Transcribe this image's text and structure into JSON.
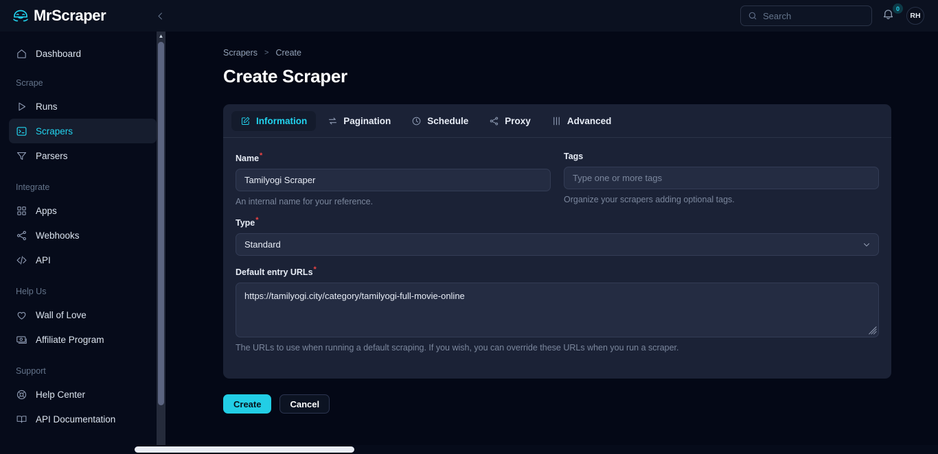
{
  "topbar": {
    "brand_name": "MrScraper",
    "logo_icon": "mrscraper-face-logo",
    "collapse_icon": "chevron-left-icon",
    "search": {
      "placeholder": "Search",
      "value": "",
      "icon": "search-icon"
    },
    "notifications": {
      "icon": "bell-icon",
      "count": "0"
    },
    "avatar_initials": "RH"
  },
  "sidebar": {
    "items": [
      {
        "label": "Dashboard",
        "icon": "home-icon",
        "active": false
      },
      {
        "label": "Runs",
        "icon": "play-icon",
        "active": false
      },
      {
        "label": "Scrapers",
        "icon": "terminal-icon",
        "active": true
      },
      {
        "label": "Parsers",
        "icon": "filter-icon",
        "active": false
      },
      {
        "label": "Apps",
        "icon": "grid-icon",
        "active": false
      },
      {
        "label": "Webhooks",
        "icon": "share-icon",
        "active": false
      },
      {
        "label": "API",
        "icon": "code-icon",
        "active": false
      },
      {
        "label": "Wall of Love",
        "icon": "heart-icon",
        "active": false
      },
      {
        "label": "Affiliate Program",
        "icon": "money-icon",
        "active": false
      },
      {
        "label": "Help Center",
        "icon": "lifebuoy-icon",
        "active": false
      },
      {
        "label": "API Documentation",
        "icon": "book-icon",
        "active": false
      }
    ],
    "groups": {
      "scrape": "Scrape",
      "integrate": "Integrate",
      "help_us": "Help Us",
      "support": "Support"
    }
  },
  "main": {
    "breadcrumb": {
      "parent": "Scrapers",
      "separator": ">",
      "current": "Create"
    },
    "page_title": "Create Scraper",
    "tabs": [
      {
        "label": "Information",
        "icon": "edit-square-icon",
        "active": true
      },
      {
        "label": "Pagination",
        "icon": "arrows-swap-icon",
        "active": false
      },
      {
        "label": "Schedule",
        "icon": "clock-icon",
        "active": false
      },
      {
        "label": "Proxy",
        "icon": "share-nodes-icon",
        "active": false
      },
      {
        "label": "Advanced",
        "icon": "sliders-icon",
        "active": false
      }
    ],
    "form": {
      "name": {
        "label": "Name",
        "required_mark": "*",
        "value": "Tamilyogi Scraper",
        "placeholder": "",
        "hint": "An internal name for your reference."
      },
      "tags": {
        "label": "Tags",
        "value": "",
        "placeholder": "Type one or more tags",
        "hint": "Organize your scrapers adding optional tags."
      },
      "type": {
        "label": "Type",
        "required_mark": "*",
        "value": "Standard",
        "options": [
          "Standard"
        ],
        "chevron_icon": "chevron-down-icon"
      },
      "entry_urls": {
        "label": "Default entry URLs",
        "required_mark": "*",
        "value": "https://tamilyogi.city/category/tamilyogi-full-movie-online",
        "hint": "The URLs to use when running a default scraping. If you wish, you can override these URLs when you run a scraper."
      }
    },
    "actions": {
      "create_label": "Create",
      "cancel_label": "Cancel"
    }
  },
  "colors": {
    "accent": "#22d3ee",
    "primary_button": "#22cee5",
    "page_bg": "#040816",
    "card_bg": "#1b2236",
    "input_bg": "#242c42",
    "required": "#ef4444"
  }
}
